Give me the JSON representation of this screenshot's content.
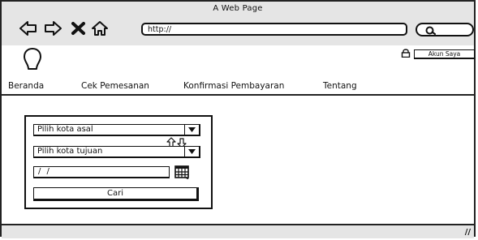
{
  "window": {
    "title": "A Web Page"
  },
  "toolbar": {
    "back_icon": "left-arrow-icon",
    "forward_icon": "right-arrow-icon",
    "close_icon": "x-icon",
    "home_icon": "home-icon",
    "url": "http://",
    "search_icon": "search-icon"
  },
  "header": {
    "logo_icon": "lightbulb-icon",
    "lock_icon": "lock-icon",
    "account_button": "Akun Saya"
  },
  "menu": {
    "items": [
      "Beranda",
      "Cek Pemesanan",
      "Konfirmasi Pembayaran",
      "Tentang"
    ]
  },
  "booking_form": {
    "origin_select": "Pilih kota asal",
    "destination_select": "Pilih kota tujuan",
    "swap_icon": "swap-arrows-icon",
    "date_value": "/ /",
    "calendar_icon": "calendar-icon",
    "submit_label": "Cari"
  },
  "colors": {
    "chrome": "#e5e5e5",
    "stroke": "#111111",
    "background": "#ffffff"
  }
}
